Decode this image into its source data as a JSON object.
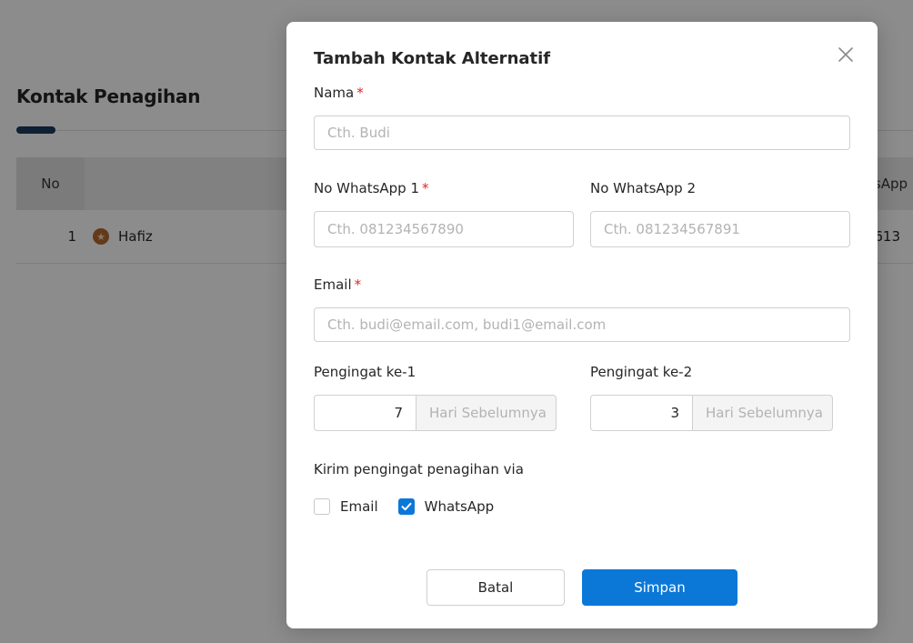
{
  "background": {
    "title": "Kontak Penagihan",
    "table": {
      "columns": {
        "no": "No",
        "whatsapp": "sApp"
      },
      "rows": [
        {
          "no": "1",
          "name": "Hafiz",
          "whatsapp": "613"
        }
      ]
    }
  },
  "modal": {
    "title": "Tambah Kontak Alternatif",
    "fields": {
      "nama": {
        "label": "Nama",
        "required": "*",
        "placeholder": "Cth. Budi",
        "value": ""
      },
      "wa1": {
        "label": "No WhatsApp 1",
        "required": "*",
        "placeholder": "Cth. 081234567890",
        "value": ""
      },
      "wa2": {
        "label": "No WhatsApp 2",
        "placeholder": "Cth. 081234567891",
        "value": ""
      },
      "email": {
        "label": "Email",
        "required": "*",
        "placeholder": "Cth. budi@email.com, budi1@email.com",
        "value": ""
      }
    },
    "reminders": [
      {
        "label": "Pengingat ke-1",
        "value": "7",
        "addon": "Hari Sebelumnya"
      },
      {
        "label": "Pengingat ke-2",
        "value": "3",
        "addon": "Hari Sebelumnya"
      }
    ],
    "via": {
      "label": "Kirim pengingat penagihan via",
      "options": [
        {
          "label": "Email",
          "checked": false
        },
        {
          "label": "WhatsApp",
          "checked": true
        }
      ]
    },
    "buttons": {
      "cancel": "Batal",
      "save": "Simpan"
    }
  },
  "colors": {
    "primary": "#0b78d8",
    "required": "#e02424",
    "overlay": "rgba(0,0,0,0.45)"
  },
  "icons": {
    "close": "close-icon",
    "check": "check-icon",
    "badge": "star-badge-icon"
  }
}
